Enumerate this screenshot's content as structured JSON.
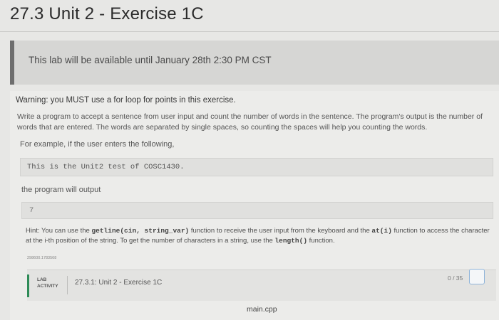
{
  "page": {
    "title": "27.3 Unit 2 - Exercise 1C"
  },
  "notice": {
    "text": "This lab will be available until January 28th 2:30 PM CST"
  },
  "content": {
    "warning": "Warning: you MUST use a for loop for points in this exercise.",
    "description": "Write a program to accept a sentence from user input and count the number of words in the sentence. The program's output is the number of words that are entered. The words are separated by single spaces, so counting the spaces will help you counting the words.",
    "example_intro": "For example, if the user enters the following,",
    "example_input": "This is the Unit2 test of COSC1430.",
    "output_intro": "the program will output",
    "example_output": "7",
    "hint": {
      "lead": "Hint: You can use the ",
      "code1": "getline(cin, string_var)",
      "mid1": " function to receive the user input from the keyboard and the ",
      "code2": "at(i)",
      "mid2": " function to access the character at the i-th position of the string. To get the number of characters in a string, use the ",
      "code3": "length()",
      "tail": " function."
    },
    "tracking_id": "298600.1783568"
  },
  "lab": {
    "label_line1": "LAB",
    "label_line2": "ACTIVITY",
    "title": "27.3.1: Unit 2 - Exercise 1C",
    "score": "0 / 35",
    "file_name": "main.cpp"
  },
  "colors": {
    "accent": "#2e8b57",
    "background": "#e7e7e5"
  }
}
